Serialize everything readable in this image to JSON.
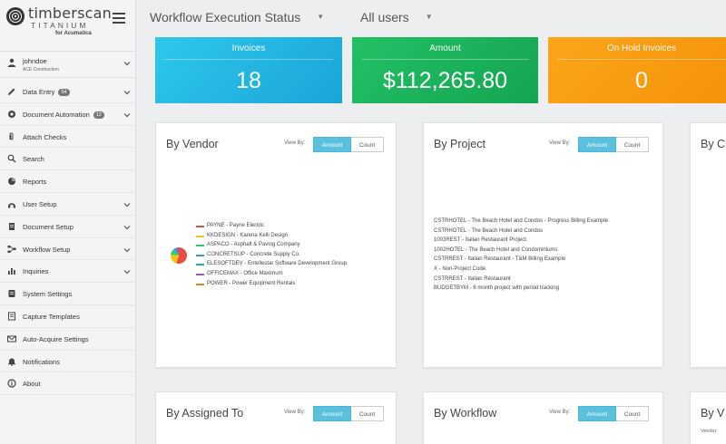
{
  "brand": {
    "name": "timberscan",
    "sub": "TITANIUM",
    "for": "for Acumatica"
  },
  "user": {
    "name": "johndoe",
    "org": "ACE Construction"
  },
  "nav": [
    {
      "label": "Data Entry",
      "badge": "54",
      "icon": "pencil-icon",
      "chevron": true
    },
    {
      "label": "Document Automation",
      "badge": "12",
      "icon": "gear-icon",
      "chevron": true
    },
    {
      "label": "Attach Checks",
      "badge": "",
      "icon": "paperclip-icon",
      "chevron": false
    },
    {
      "label": "Search",
      "badge": "",
      "icon": "search-icon",
      "chevron": false
    },
    {
      "label": "Reports",
      "badge": "",
      "icon": "reports-icon",
      "chevron": false
    },
    {
      "label": "User Setup",
      "badge": "",
      "icon": "user-setup-icon",
      "chevron": true
    },
    {
      "label": "Document Setup",
      "badge": "",
      "icon": "document-icon",
      "chevron": true
    },
    {
      "label": "Workflow Setup",
      "badge": "",
      "icon": "workflow-icon",
      "chevron": true
    },
    {
      "label": "Inquiries",
      "badge": "",
      "icon": "bar-chart-icon",
      "chevron": true
    },
    {
      "label": "System Settings",
      "badge": "",
      "icon": "settings-icon",
      "chevron": false
    },
    {
      "label": "Capture Templates",
      "badge": "",
      "icon": "template-icon",
      "chevron": false
    },
    {
      "label": "Auto-Acquire Settings",
      "badge": "",
      "icon": "envelope-icon",
      "chevron": false
    },
    {
      "label": "Notifications",
      "badge": "",
      "icon": "bell-icon",
      "chevron": false
    },
    {
      "label": "About",
      "badge": "",
      "icon": "info-icon",
      "chevron": false
    }
  ],
  "topbar": {
    "workflow": "Workflow Execution Status",
    "users": "All users"
  },
  "kpis": {
    "invoices": {
      "label": "Invoices",
      "value": "18"
    },
    "amount": {
      "label": "Amount",
      "value": "$112,265.80"
    },
    "hold": {
      "label": "On Hold Invoices",
      "value": "0"
    }
  },
  "colors": {
    "invoices": "#1fb3e0",
    "amount": "#1cb35c",
    "hold": "#f89c10",
    "toggle_active": "#5bc0de"
  },
  "viewby": {
    "label": "View By:",
    "amount": "Amount",
    "count": "Count"
  },
  "cards": {
    "vendor": "By Vendor",
    "project": "By Project",
    "cust": "By Cu",
    "assigned": "By Assigned To",
    "workflow": "By Workflow",
    "v2": "By V",
    "v2_sub": "Vendor"
  },
  "vendor_legend": [
    {
      "label": "PAYNE - Payne Electric",
      "color": "#e74c3c"
    },
    {
      "label": "KKDESIGN - Karena Kelli Design",
      "color": "#f1c40f"
    },
    {
      "label": "ASPACO - Asphalt & Paving Company",
      "color": "#2ecc71"
    },
    {
      "label": "CONCRETSUP - Concrete Supply Co.",
      "color": "#3498db"
    },
    {
      "label": "ELESOFTDEV - Entellestar Software Development Group",
      "color": "#1abc9c"
    },
    {
      "label": "OFFICEMAX - Office Maximum",
      "color": "#9b59b6"
    },
    {
      "label": "POWER - Power Equipment Rentals",
      "color": "#e67e22"
    }
  ],
  "project_list": [
    "CSTRHOTEL - The Beach Hotel and Condos - Progress Billing Example",
    "CSTRHOTEL - The Beach Hotel and Condos",
    "1003REST - Italian Restaurant Project",
    "1002HOTEL - The Beach Hotel and Condominiums",
    "CSTRREST - Italian Restaurant - T&M Billing Example",
    "X - Non-Project Code.",
    "CSTRREST - Italian Restaurant",
    "BUDGETBYM - 6 month project with period tracking"
  ]
}
